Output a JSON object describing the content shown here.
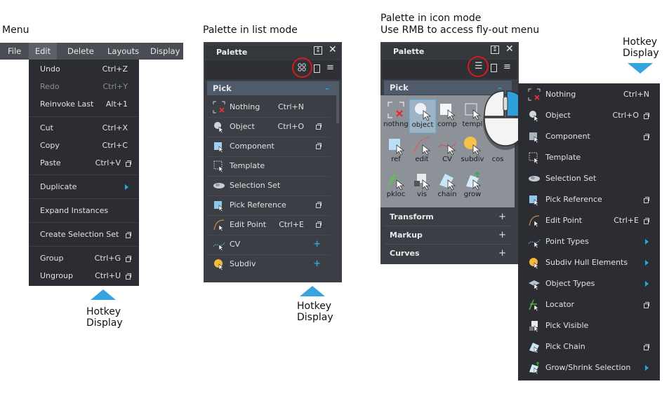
{
  "captions": {
    "menu": "Menu",
    "palette_list": "Palette in list mode",
    "palette_icon_line1": "Palette in icon mode",
    "palette_icon_line2": "Use RMB to access fly-out menu",
    "hotkey_a_line1": "Hotkey",
    "hotkey_a_line2": "Display",
    "hotkey_b_line1": "Hotkey",
    "hotkey_b_line2": "Display",
    "hotkey_c_line1": "Hotkey",
    "hotkey_c_line2": "Display"
  },
  "menubar": {
    "items": [
      "File",
      "Edit",
      "Delete",
      "Layouts",
      "Display"
    ],
    "active": "Edit"
  },
  "edit_menu": [
    {
      "label": "Undo",
      "key": "Ctrl+Z"
    },
    {
      "label": "Redo",
      "key": "Ctrl+Y",
      "disabled": true
    },
    {
      "label": "Reinvoke Last",
      "key": "Alt+1"
    },
    {
      "label": "Cut",
      "key": "Ctrl+X"
    },
    {
      "label": "Copy",
      "key": "Ctrl+C"
    },
    {
      "label": "Paste",
      "key": "Ctrl+V"
    },
    {
      "label": "Duplicate",
      "key": ""
    },
    {
      "label": "Expand Instances",
      "key": ""
    },
    {
      "label": "Create Selection Set",
      "key": ""
    },
    {
      "label": "Group",
      "key": "Ctrl+G"
    },
    {
      "label": "Ungroup",
      "key": "Ctrl+U"
    }
  ],
  "palette_list": {
    "title": "Palette",
    "section": "Pick",
    "collapse": "–",
    "items": [
      {
        "label": "Nothing",
        "key": "Ctrl+N"
      },
      {
        "label": "Object",
        "key": "Ctrl+O"
      },
      {
        "label": "Component",
        "key": ""
      },
      {
        "label": "Template",
        "key": ""
      },
      {
        "label": "Selection Set",
        "key": ""
      },
      {
        "label": "Pick Reference",
        "key": ""
      },
      {
        "label": "Edit Point",
        "key": "Ctrl+E"
      },
      {
        "label": "CV",
        "key": ""
      },
      {
        "label": "Subdiv",
        "key": ""
      }
    ]
  },
  "palette_icon": {
    "title": "Palette",
    "section": "Pick",
    "collapse": "–",
    "cells": [
      "nothng",
      "object",
      "comp",
      "templ",
      "ref",
      "edit",
      "CV",
      "subdiv",
      "cos",
      "pkloc",
      "vis",
      "chain",
      "grow"
    ],
    "sections": [
      "Transform",
      "Markup",
      "Curves"
    ],
    "plus": "+"
  },
  "hotkey_menu": [
    {
      "label": "Nothing",
      "key": "Ctrl+N"
    },
    {
      "label": "Object",
      "key": "Ctrl+O"
    },
    {
      "label": "Component",
      "key": ""
    },
    {
      "label": "Template",
      "key": ""
    },
    {
      "label": "Selection Set",
      "key": ""
    },
    {
      "label": "Pick Reference",
      "key": ""
    },
    {
      "label": "Edit Point",
      "key": "Ctrl+E"
    },
    {
      "label": "Point Types",
      "key": ""
    },
    {
      "label": "Subdiv Hull Elements",
      "key": ""
    },
    {
      "label": "Object Types",
      "key": ""
    },
    {
      "label": "Locator",
      "key": ""
    },
    {
      "label": "Pick Visible",
      "key": ""
    },
    {
      "label": "Pick Chain",
      "key": ""
    },
    {
      "label": "Grow/Shrink Selection",
      "key": ""
    }
  ],
  "colors": {
    "accent": "#36a5de",
    "highlight_ring": "#d81a1a",
    "menu_bg": "#2b2d32"
  }
}
